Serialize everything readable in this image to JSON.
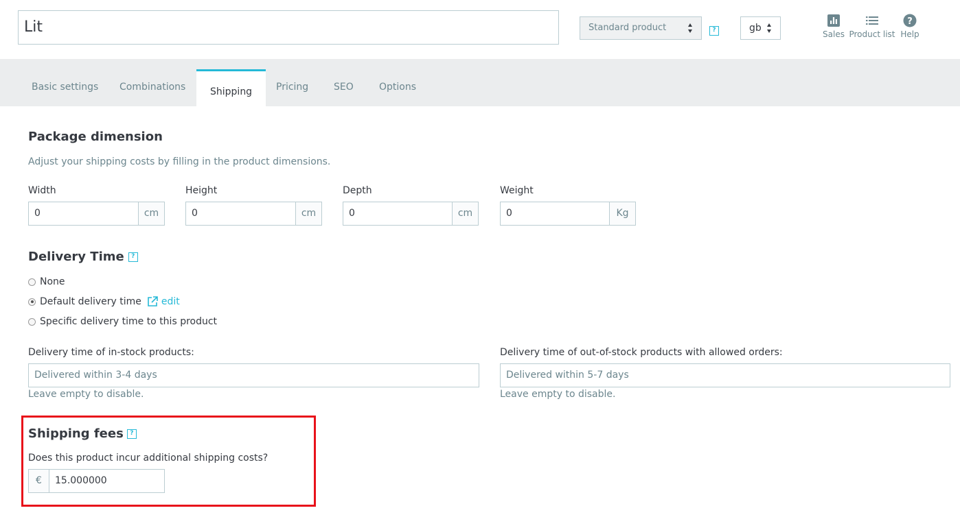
{
  "header": {
    "product_name": "Lit",
    "product_type": "Standard product",
    "language": "gb",
    "toolbar": [
      {
        "label": "Sales",
        "icon": "bar-chart-icon"
      },
      {
        "label": "Product list",
        "icon": "list-icon"
      },
      {
        "label": "Help",
        "icon": "help-circle-icon"
      }
    ]
  },
  "tabs": [
    "Basic settings",
    "Combinations",
    "Shipping",
    "Pricing",
    "SEO",
    "Options"
  ],
  "active_tab": "Shipping",
  "package": {
    "title": "Package dimension",
    "description": "Adjust your shipping costs by filling in the product dimensions.",
    "fields": [
      {
        "label": "Width",
        "value": "0",
        "unit": "cm"
      },
      {
        "label": "Height",
        "value": "0",
        "unit": "cm"
      },
      {
        "label": "Depth",
        "value": "0",
        "unit": "cm"
      },
      {
        "label": "Weight",
        "value": "0",
        "unit": "Kg"
      }
    ]
  },
  "delivery": {
    "title": "Delivery Time",
    "options": [
      "None",
      "Default delivery time",
      "Specific delivery time to this product"
    ],
    "selected": "Default delivery time",
    "edit_label": "edit",
    "in_stock_label": "Delivery time of in-stock products:",
    "in_stock_placeholder": "Delivered within 3-4 days",
    "out_stock_label": "Delivery time of out-of-stock products with allowed orders:",
    "out_stock_placeholder": "Delivered within 5-7 days",
    "hint": "Leave empty to disable."
  },
  "shipping_fees": {
    "title": "Shipping fees",
    "question": "Does this product incur additional shipping costs?",
    "currency": "€",
    "value": "15.000000"
  },
  "help_glyph": "?",
  "colors": {
    "accent": "#25b9d7",
    "highlight": "#e8111a",
    "strip": "#ebedee"
  }
}
